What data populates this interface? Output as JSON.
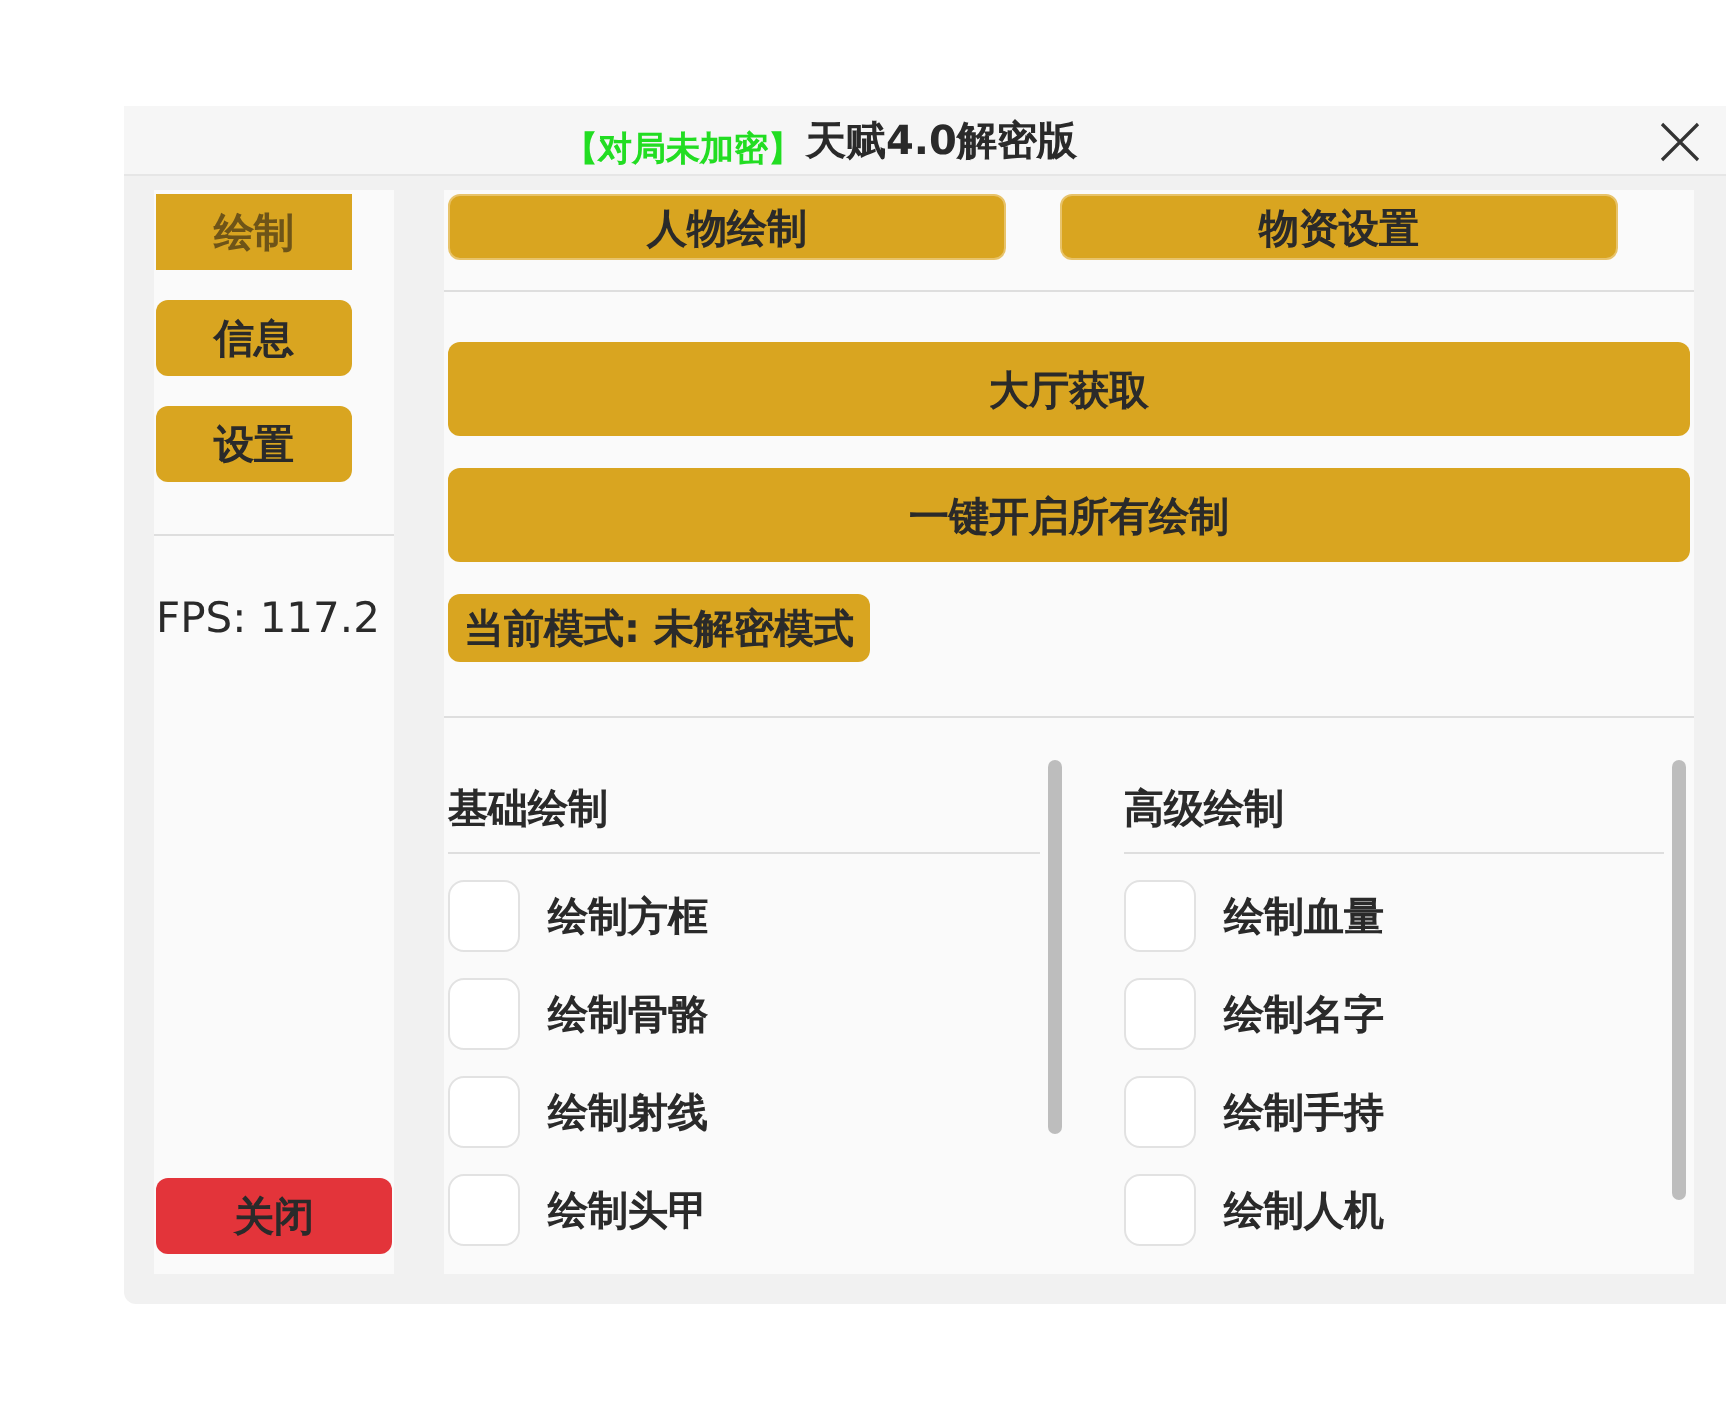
{
  "window": {
    "title": "天赋4.0解密版",
    "status_overlay": "【对局未加密】"
  },
  "sidebar": {
    "items": [
      {
        "label": "绘制",
        "selected": true
      },
      {
        "label": "信息",
        "selected": false
      },
      {
        "label": "设置",
        "selected": false
      }
    ],
    "fps": "FPS: 117.2",
    "close_button": "关闭"
  },
  "top_tabs": [
    {
      "label": "人物绘制"
    },
    {
      "label": "物资设置"
    }
  ],
  "actions": [
    "大厅获取",
    "一键开启所有绘制"
  ],
  "mode_badge": "当前模式: 未解密模式",
  "sections": [
    {
      "title": "基础绘制",
      "options": [
        {
          "label": "绘制方框",
          "checked": false
        },
        {
          "label": "绘制骨骼",
          "checked": false
        },
        {
          "label": "绘制射线",
          "checked": false
        },
        {
          "label": "绘制头甲",
          "checked": false
        }
      ]
    },
    {
      "title": "高级绘制",
      "options": [
        {
          "label": "绘制血量",
          "checked": false
        },
        {
          "label": "绘制名字",
          "checked": false
        },
        {
          "label": "绘制手持",
          "checked": false
        },
        {
          "label": "绘制人机",
          "checked": false
        }
      ]
    }
  ]
}
